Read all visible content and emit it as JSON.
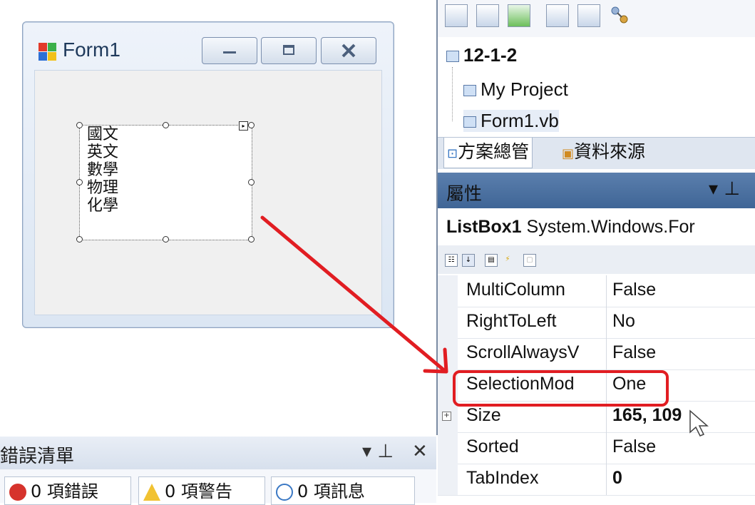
{
  "form": {
    "title": "Form1",
    "controls": {
      "minimize": "—",
      "maximize": "□",
      "close": "✕"
    },
    "listbox_items": [
      "國文",
      "英文",
      "數學",
      "物理",
      "化學"
    ]
  },
  "error_list": {
    "title": "錯誤清單",
    "pin": "▾ ⊥",
    "close": "✕",
    "tabs": [
      {
        "label": "0 項錯誤",
        "icon": "error-icon",
        "color": "#d6332c"
      },
      {
        "label": "0 項警告",
        "icon": "warning-icon",
        "color": "#f1c232"
      },
      {
        "label": "0 項訊息",
        "icon": "info-icon",
        "color": "#3a78c4"
      }
    ]
  },
  "solution_explorer": {
    "project": "12-1-2",
    "items": [
      "My Project",
      "Form1.vb"
    ],
    "tabs": [
      "方案總管",
      "資料來源"
    ]
  },
  "properties": {
    "title": "屬性",
    "pin": "▾ ⊥",
    "object_name": "ListBox1",
    "object_type": "System.Windows.For",
    "rows": [
      {
        "name": "MultiColumn",
        "value": "False",
        "bold": false
      },
      {
        "name": "RightToLeft",
        "value": "No",
        "bold": false
      },
      {
        "name": "ScrollAlwaysV",
        "value": "False",
        "bold": false
      },
      {
        "name": "SelectionMod",
        "value": "One",
        "bold": false
      },
      {
        "name": "Size",
        "value": "165, 109",
        "bold": true,
        "expandable": true
      },
      {
        "name": "Sorted",
        "value": "False",
        "bold": false
      },
      {
        "name": "TabIndex",
        "value": "0",
        "bold": true
      }
    ]
  },
  "colors": {
    "annotation": "#e11d22",
    "panel_header": "#4a6fa0"
  }
}
